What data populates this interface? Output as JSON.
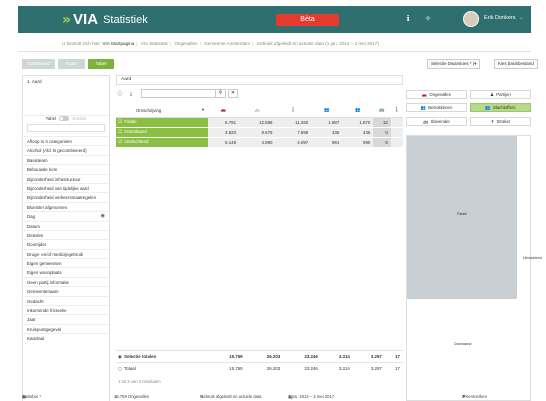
{
  "header": {
    "logo_chevrons": "»",
    "logo_via": "VIA",
    "logo_statistiek": "Statistiek",
    "beta_label": "Bèta",
    "info_icon": "ℹ",
    "help_icon": "✧",
    "user_name": "Erik Donkers",
    "user_chevron": "⌄",
    "bg_color": "#2f6f6f",
    "beta_color": "#e53a2e"
  },
  "breadcrumb": {
    "prefix": "U bevindt zich hier:",
    "items": [
      "VIA Startpagina",
      "VIA Statistiek",
      "Ongevallen",
      "Gemeente Amsterdam",
      "Gebruik afgeleidt en actuele data (1 jan. 2014 – 2 mei 2017)"
    ]
  },
  "toolbar": {
    "btn1": "Dashboard",
    "btn2": "Kaart",
    "btn3": "Tabel",
    "selectie_label": "Selectie Dwarstoes * (▾",
    "basisbestand_label": "Kies basisbestand"
  },
  "left_panel": {
    "selected": "1.   Aard",
    "toggle_on": "Tabel",
    "toggle_off": "Grafiek",
    "items": [
      "Afloop in 3 categorieën",
      "Alcohol (Afd. B gecombineerd)",
      "Basisteam",
      "Bebouwde kom",
      "Bijzonderheid infrastructuur",
      "Bijzonderheid van tijdelijke aard",
      "Bijzonderheid verkeersmaatregelen",
      "Bloeiste! afgenomen",
      "Dag",
      "Datum",
      "Deleden",
      "Doorrijder",
      "Drugs- en/of medicijngebruik",
      "Eigen gemeenten",
      "Eigen woonplaats",
      "Geen partij informatie",
      "Gemeentenaam",
      "Gedacht",
      "Inkomende frictoeke",
      "Jaar",
      "Kruispuntgegeval",
      "Kwartaal"
    ],
    "eye_icon": "◉"
  },
  "center": {
    "title": "Aard",
    "tool_info": "ⓘ",
    "tool_download": "⤓",
    "search_icon": "⚲",
    "clear_icon": "✕",
    "col_description": "Omschrijving",
    "col_icons": [
      "🚗",
      "🚲",
      "🚶",
      "👥",
      "👥",
      "🚌",
      "🚶",
      "♟"
    ],
    "rows": [
      {
        "label": "Fatale",
        "values": [
          "6.791",
          "12.598",
          "11.260",
          "1.887",
          "1.870",
          "12"
        ]
      },
      {
        "label": "Doorslaand",
        "values": [
          "3.820",
          "8.675",
          "7.899",
          "436",
          "436",
          "0"
        ]
      },
      {
        "label": "Uitvluchtend",
        "values": [
          "5.148",
          "4.990",
          "4.097",
          "991",
          "990",
          "5"
        ]
      }
    ],
    "total_selection_label": "Selectie totalen",
    "total_selection": [
      "15.759",
      "26.203",
      "23.246",
      "3.314",
      "3.297",
      "17"
    ],
    "total_label": "Totaal",
    "total": [
      "15.759",
      "26.203",
      "23.246",
      "3.314",
      "3.297",
      "17"
    ],
    "count_text": "1 tot 3 van 3 resultaten",
    "accent_color": "#8bbf44"
  },
  "right_panel": {
    "buttons": [
      {
        "icon": "🚗",
        "label": "Ongevallen",
        "active": false
      },
      {
        "icon": "♟",
        "label": "Partijen",
        "active": false
      },
      {
        "icon": "👥",
        "label": "Betrokkenen",
        "active": false
      },
      {
        "icon": "👥",
        "label": "Slachtoffers",
        "active": true
      },
      {
        "icon": "🚌",
        "label": "Slavender",
        "active": false
      },
      {
        "icon": "✝",
        "label": "Straker",
        "active": false
      }
    ],
    "label_fatale": "Fatale",
    "label_uitvluchtend": "Uitvluchtend",
    "label_doorslaand": "Doorslaand"
  },
  "footer": {
    "items": [
      {
        "icon": "▦",
        "text": "Basisbor *"
      },
      {
        "icon": "⚔",
        "text": "15.759 Ongevallen"
      },
      {
        "icon": "✎",
        "text": "Gebruik afgeleidt en actuele data"
      },
      {
        "icon": "▦",
        "text": "1 jan. 2014 – 2 mei 2017"
      },
      {
        "icon": "⚑",
        "text": "3 Kenmerken"
      }
    ]
  }
}
